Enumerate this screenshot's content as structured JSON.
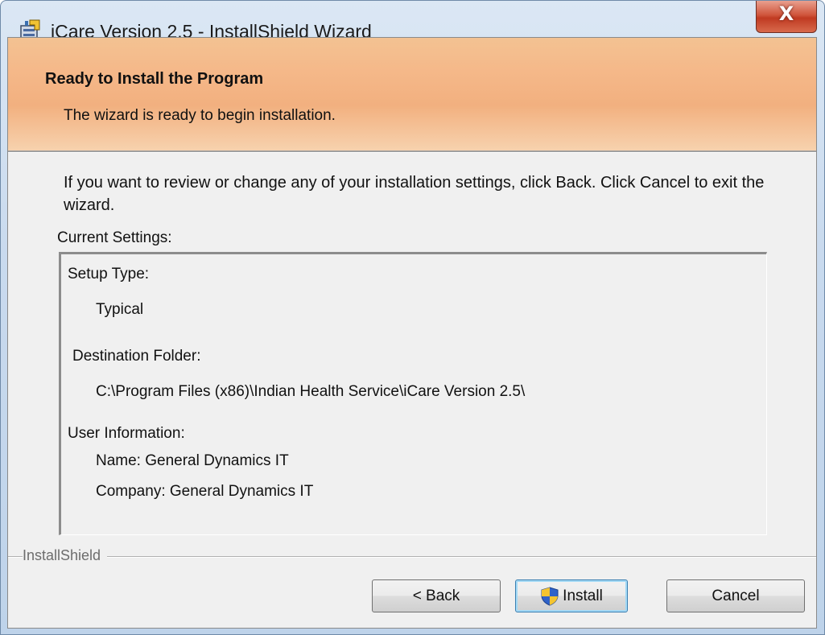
{
  "window": {
    "title": "iCare Version 2.5 - InstallShield Wizard",
    "close_glyph": "X"
  },
  "banner": {
    "title": "Ready to Install the Program",
    "subtitle": "The wizard is ready to begin installation."
  },
  "intro": "If you want to review or change any of your installation settings, click Back. Click Cancel to exit the wizard.",
  "settings": {
    "label": "Current Settings:",
    "setup_type_label": "Setup Type:",
    "setup_type_value": "Typical",
    "destination_label": "Destination Folder:",
    "destination_value": "C:\\Program Files (x86)\\Indian Health Service\\iCare Version 2.5\\",
    "user_info_label": "User Information:",
    "name_line": "Name: General Dynamics IT",
    "company_line": "Company: General Dynamics IT"
  },
  "footer": {
    "brand": "InstallShield",
    "back_label": "< Back",
    "install_label": "Install",
    "cancel_label": "Cancel"
  },
  "icons": {
    "app": "installer-icon",
    "close": "close-icon",
    "uac": "uac-shield-icon"
  }
}
